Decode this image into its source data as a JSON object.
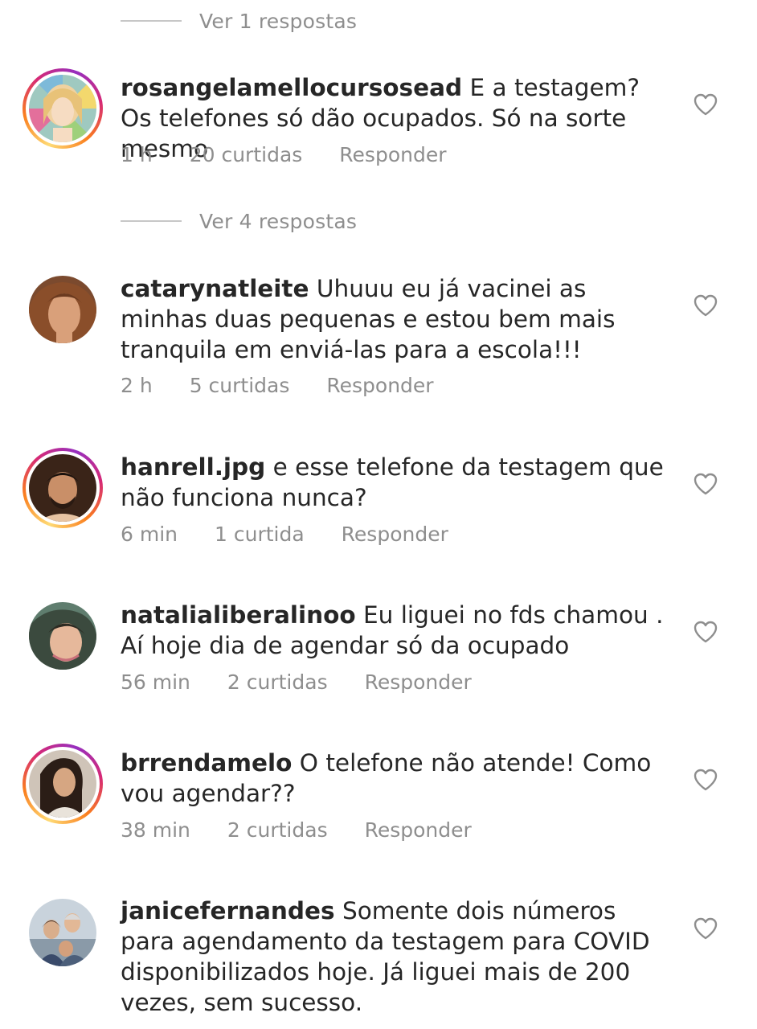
{
  "top_replies": {
    "label": "Ver 1 respostas"
  },
  "comments": [
    {
      "username": "rosangelamellocursosead",
      "text": "E a testagem? Os telefones só dão ocupados. Só na sorte mesmo",
      "time": "1 h",
      "likes": "20 curtidas",
      "reply": "Responder",
      "has_story_ring": true,
      "view_replies": "Ver 4 respostas"
    },
    {
      "username": "catarynatleite",
      "text": "Uhuuu eu já vacinei as minhas duas pequenas e estou bem mais tranquila em enviá-las para a escola!!!",
      "time": "2 h",
      "likes": "5 curtidas",
      "reply": "Responder",
      "has_story_ring": false
    },
    {
      "username": "hanrell.jpg",
      "text": "e esse telefone da testagem que não funciona nunca?",
      "time": "6 min",
      "likes": "1 curtida",
      "reply": "Responder",
      "has_story_ring": true
    },
    {
      "username": "natalialiberalinoo",
      "text": "Eu liguei no fds chamou . Aí hoje dia de agendar só da ocupado",
      "time": "56 min",
      "likes": "2 curtidas",
      "reply": "Responder",
      "has_story_ring": false
    },
    {
      "username": "brrendamelo",
      "text": "O telefone não atende! Como vou agendar??",
      "time": "38 min",
      "likes": "2 curtidas",
      "reply": "Responder",
      "has_story_ring": true
    },
    {
      "username": "janicefernandes",
      "text": "Somente dois números para agendamento da testagem para COVID disponibilizados hoje. Já liguei mais de 200 vezes, sem sucesso.",
      "time": "",
      "likes": "",
      "reply": "",
      "has_story_ring": false
    }
  ],
  "icons": {
    "like": "heart-outline-icon"
  },
  "colors": {
    "text": "#262626",
    "secondary": "#8e8e8e",
    "divider": "#c7c7c7"
  }
}
